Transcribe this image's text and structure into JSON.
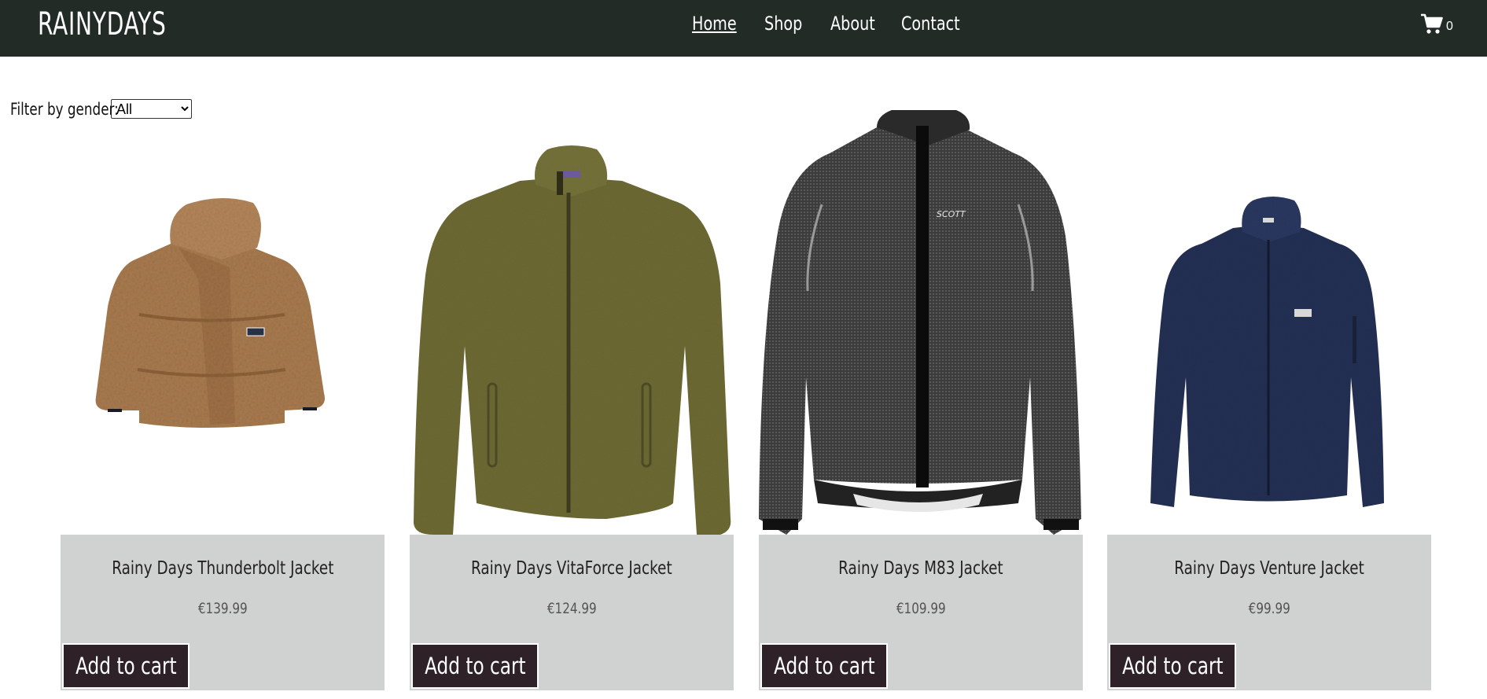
{
  "header": {
    "logo": "RAINYDAYS",
    "nav": [
      "Home",
      "Shop",
      "About",
      "Contact"
    ],
    "cart_count": "0",
    "background": "#222b26"
  },
  "filter": {
    "label": "Filter by gender:",
    "selected": "All"
  },
  "products": [
    {
      "name": "Rainy Days Thunderbolt Jacket",
      "price": "€139.99",
      "button": "Add to cart",
      "color": "#a87a4e"
    },
    {
      "name": "Rainy Days VitaForce Jacket",
      "price": "€124.99",
      "button": "Add to cart",
      "color": "#6d6a33"
    },
    {
      "name": "Rainy Days M83 Jacket",
      "price": "€109.99",
      "button": "Add to cart",
      "color": "#3c3c3c"
    },
    {
      "name": "Rainy Days Venture Jacket",
      "price": "€99.99",
      "button": "Add to cart",
      "color": "#243154"
    }
  ]
}
